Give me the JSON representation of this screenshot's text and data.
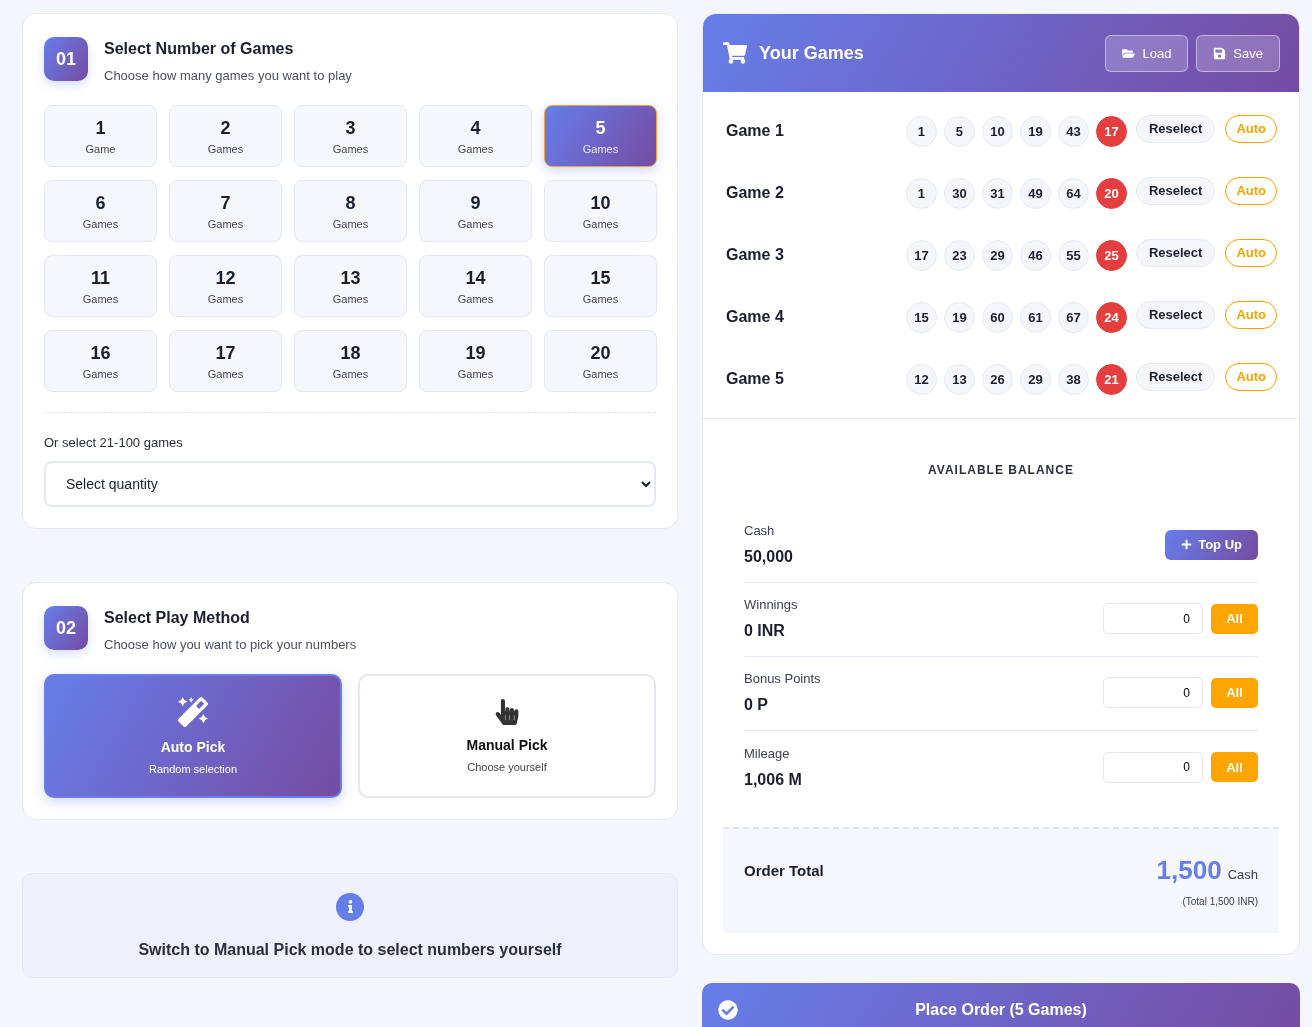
{
  "step_games": {
    "number": "01",
    "title": "Select Number of Games",
    "subtitle": "Choose how many games you want to play",
    "options": [
      {
        "count": "1",
        "unit": "Game",
        "selected": false
      },
      {
        "count": "2",
        "unit": "Games",
        "selected": false
      },
      {
        "count": "3",
        "unit": "Games",
        "selected": false
      },
      {
        "count": "4",
        "unit": "Games",
        "selected": false
      },
      {
        "count": "5",
        "unit": "Games",
        "selected": true
      },
      {
        "count": "6",
        "unit": "Games",
        "selected": false
      },
      {
        "count": "7",
        "unit": "Games",
        "selected": false
      },
      {
        "count": "8",
        "unit": "Games",
        "selected": false
      },
      {
        "count": "9",
        "unit": "Games",
        "selected": false
      },
      {
        "count": "10",
        "unit": "Games",
        "selected": false
      },
      {
        "count": "11",
        "unit": "Games",
        "selected": false
      },
      {
        "count": "12",
        "unit": "Games",
        "selected": false
      },
      {
        "count": "13",
        "unit": "Games",
        "selected": false
      },
      {
        "count": "14",
        "unit": "Games",
        "selected": false
      },
      {
        "count": "15",
        "unit": "Games",
        "selected": false
      },
      {
        "count": "16",
        "unit": "Games",
        "selected": false
      },
      {
        "count": "17",
        "unit": "Games",
        "selected": false
      },
      {
        "count": "18",
        "unit": "Games",
        "selected": false
      },
      {
        "count": "19",
        "unit": "Games",
        "selected": false
      },
      {
        "count": "20",
        "unit": "Games",
        "selected": false
      }
    ],
    "more_label": "Or select 21-100 games",
    "quantity_select": "Select quantity"
  },
  "step_method": {
    "number": "02",
    "title": "Select Play Method",
    "subtitle": "Choose how you want to pick your numbers",
    "options": [
      {
        "kind": "auto",
        "title": "Auto Pick",
        "subtitle": "Random selection",
        "selected": true
      },
      {
        "kind": "manual",
        "title": "Manual Pick",
        "subtitle": "Choose yourself",
        "selected": false
      }
    ]
  },
  "info": {
    "text": "Switch to Manual Pick mode to select numbers yourself"
  },
  "your_games": {
    "title": "Your Games",
    "buttons": [
      {
        "kind": "load",
        "label": "Load"
      },
      {
        "kind": "save",
        "label": "Save"
      }
    ],
    "games": [
      {
        "label": "Game 1",
        "numbers": [
          "1",
          "5",
          "10",
          "19",
          "43"
        ],
        "bonus": "17",
        "reselect": "Reselect",
        "auto": "Auto"
      },
      {
        "label": "Game 2",
        "numbers": [
          "1",
          "30",
          "31",
          "49",
          "64"
        ],
        "bonus": "20",
        "reselect": "Reselect",
        "auto": "Auto"
      },
      {
        "label": "Game 3",
        "numbers": [
          "17",
          "23",
          "29",
          "46",
          "55"
        ],
        "bonus": "25",
        "reselect": "Reselect",
        "auto": "Auto"
      },
      {
        "label": "Game 4",
        "numbers": [
          "15",
          "19",
          "60",
          "61",
          "67"
        ],
        "bonus": "24",
        "reselect": "Reselect",
        "auto": "Auto"
      },
      {
        "label": "Game 5",
        "numbers": [
          "12",
          "13",
          "26",
          "29",
          "38"
        ],
        "bonus": "21",
        "reselect": "Reselect",
        "auto": "Auto"
      }
    ]
  },
  "balance": {
    "title": "AVAILABLE BALANCE",
    "items": [
      {
        "kind": "topup",
        "label": "Cash",
        "value": "50,000",
        "button": "Top Up"
      },
      {
        "kind": "redeem",
        "label": "Winnings",
        "value": "0 INR",
        "input_value": "0",
        "button": "All"
      },
      {
        "kind": "redeem",
        "label": "Bonus Points",
        "value": "0 P",
        "input_value": "0",
        "button": "All"
      },
      {
        "kind": "redeem",
        "label": "Mileage",
        "value": "1,006 M",
        "input_value": "0",
        "button": "All"
      }
    ]
  },
  "order_total": {
    "label": "Order Total",
    "amount": "1,500",
    "unit": "Cash",
    "note": "(Total 1,500 INR)"
  },
  "place_order": {
    "label": "Place Order (5 Games)"
  }
}
